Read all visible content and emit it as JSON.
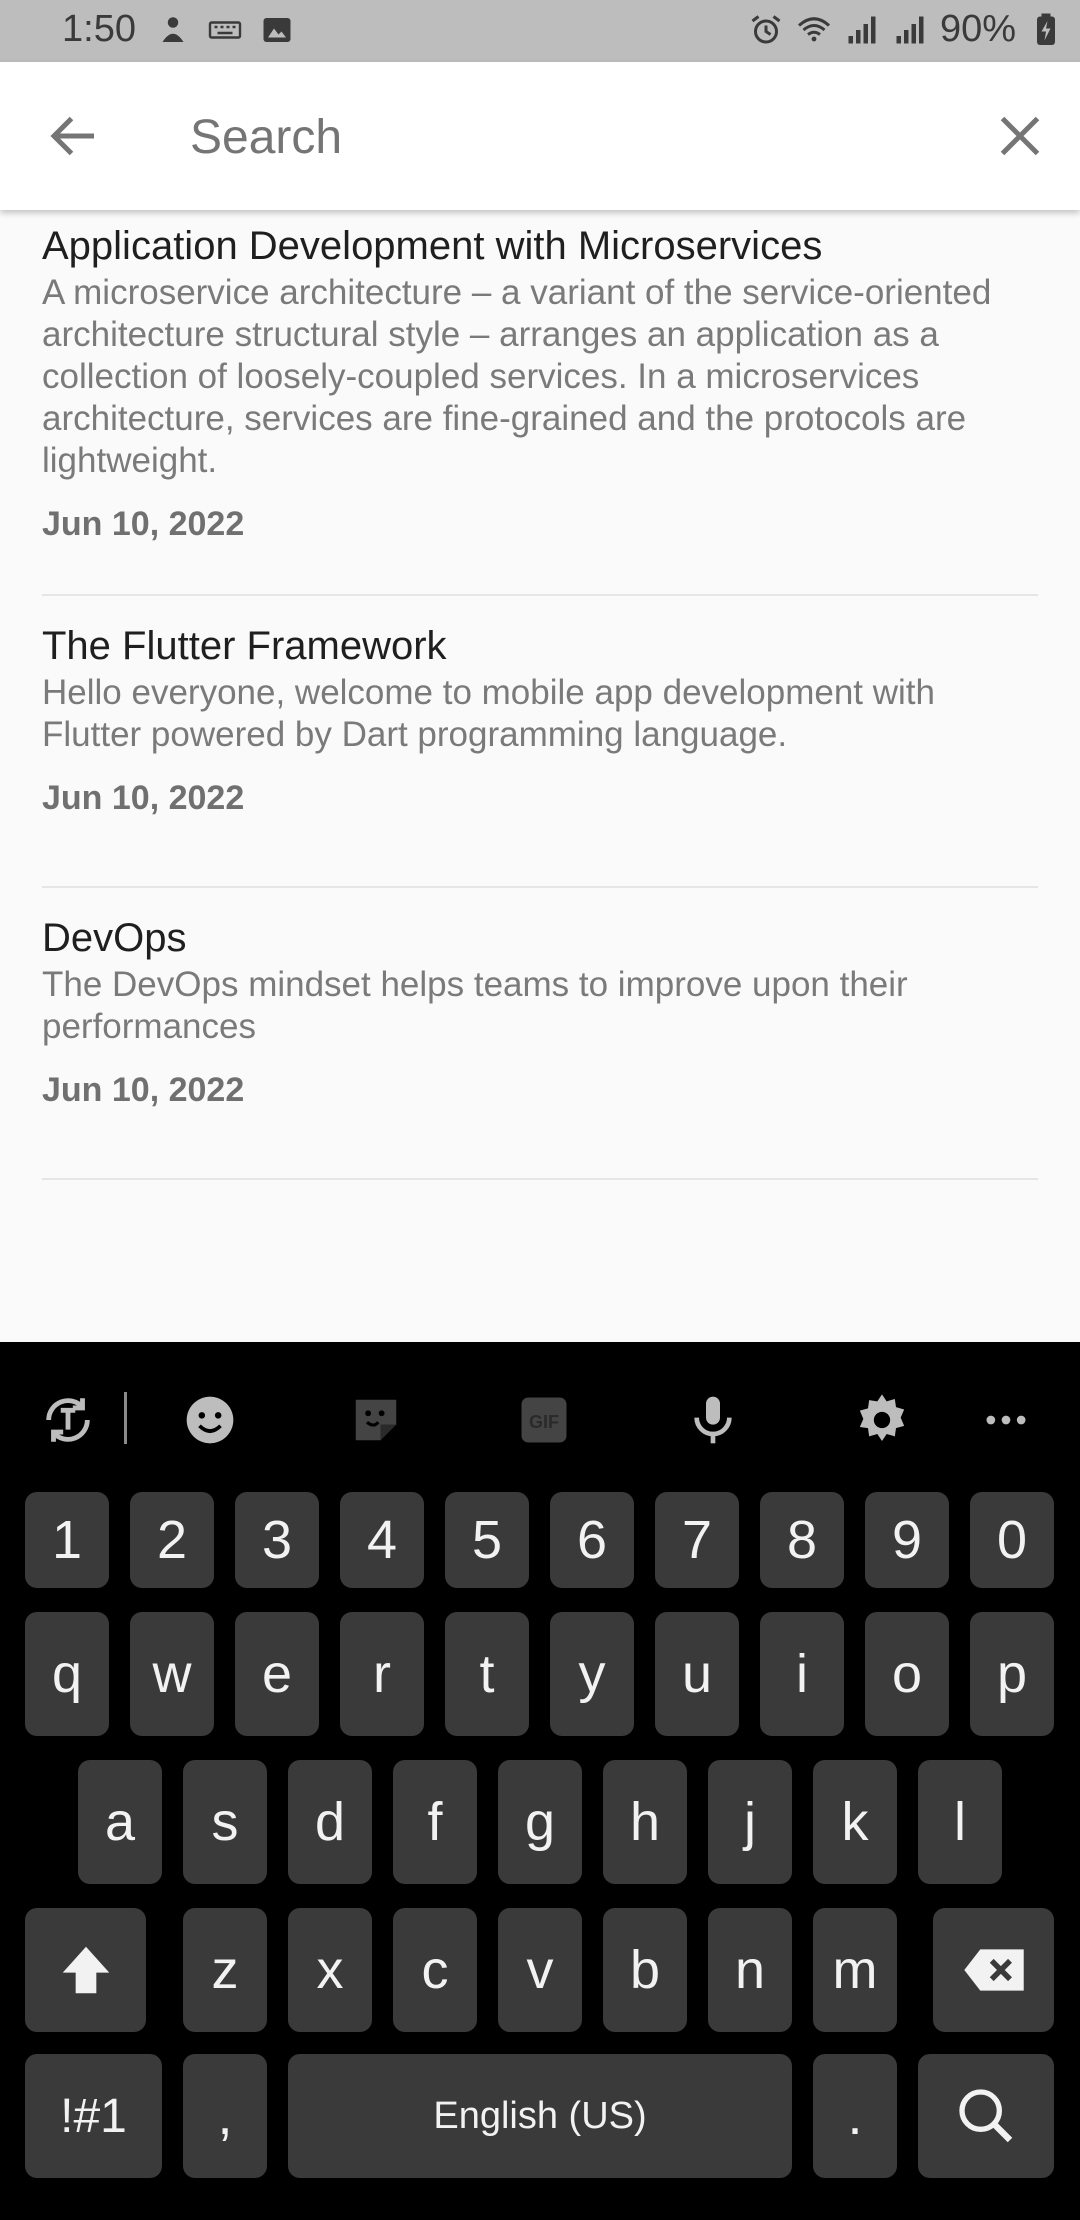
{
  "status_bar": {
    "time": "1:50",
    "battery": "90%",
    "left_icons": [
      "notification-icon",
      "keyboard-icon",
      "image-icon"
    ],
    "right_icons": [
      "alarm-icon",
      "wifi-icon",
      "signal-icon",
      "signal-icon",
      "battery-charging-icon"
    ]
  },
  "app_bar": {
    "search_placeholder": "Search",
    "back_icon": "arrow-back-icon",
    "close_icon": "close-icon"
  },
  "results": [
    {
      "title": "Application Development with Microservices",
      "description": "A microservice architecture – a variant of the service-oriented architecture structural style – arranges an application as a collection of loosely-coupled services. In a microservices architecture, services are fine-grained and the protocols are lightweight.",
      "date": "Jun 10, 2022"
    },
    {
      "title": "The Flutter Framework",
      "description": "Hello everyone, welcome to mobile app development with Flutter powered by Dart programming language.",
      "date": "Jun 10, 2022"
    },
    {
      "title": "DevOps",
      "description": "The DevOps mindset helps teams to improve upon their performances",
      "date": "Jun 10, 2022"
    }
  ],
  "keyboard": {
    "toolbar": [
      "translate-icon",
      "emoji-icon",
      "sticker-icon",
      "gif-icon",
      "microphone-icon",
      "settings-icon",
      "more-icon"
    ],
    "gif_label": "GIF",
    "number_row": [
      "1",
      "2",
      "3",
      "4",
      "5",
      "6",
      "7",
      "8",
      "9",
      "0"
    ],
    "row1": [
      "q",
      "w",
      "e",
      "r",
      "t",
      "y",
      "u",
      "i",
      "o",
      "p"
    ],
    "row2": [
      "a",
      "s",
      "d",
      "f",
      "g",
      "h",
      "j",
      "k",
      "l"
    ],
    "row3": [
      "z",
      "x",
      "c",
      "v",
      "b",
      "n",
      "m"
    ],
    "symbols": "!#1",
    "comma": ",",
    "space": "English (US)",
    "period": "."
  }
}
